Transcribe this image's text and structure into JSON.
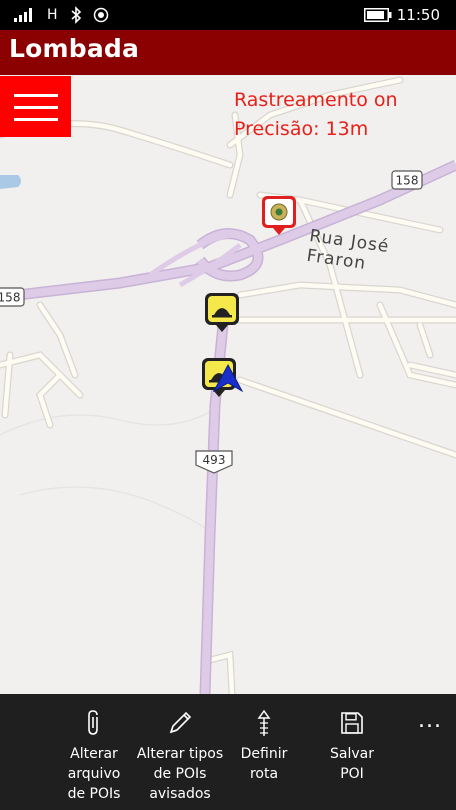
{
  "status_bar": {
    "signal": "signal-icon",
    "network": "H",
    "bluetooth": "bluetooth-icon",
    "location": "location-icon",
    "battery": "battery-icon",
    "time": "11:50"
  },
  "app": {
    "title": "Lombada"
  },
  "tracking": {
    "status": "Rastreamento on",
    "precision": "Precisão: 13m"
  },
  "map": {
    "street_name": "Rua José Fraron",
    "route_shields": {
      "r158_right": "158",
      "r158_left": "158",
      "r493": "493"
    },
    "markers": {
      "police": "police-marker-icon",
      "speed_bump_1": "speed-bump-marker-icon",
      "speed_bump_2": "speed-bump-marker-icon",
      "user": "navigation-arrow-icon"
    },
    "colors": {
      "main_road": "#d9c6e3",
      "secondary_road": "#fefcf2",
      "background": "#f1f0ee"
    }
  },
  "app_bar": {
    "buttons": [
      {
        "icon": "paperclip-icon",
        "label": "Alterar\narquivo\nde POIs"
      },
      {
        "icon": "pencil-icon",
        "label": "Alterar tipos\nde POIs\navisados"
      },
      {
        "icon": "route-icon",
        "label": "Definir\nrota"
      },
      {
        "icon": "save-icon",
        "label": "Salvar\nPOI"
      }
    ],
    "more": "..."
  },
  "colors": {
    "header": "#8b0000",
    "menu_button": "#ff0000",
    "tracking_text": "#e8201a",
    "app_bar": "#1f1f1f"
  }
}
